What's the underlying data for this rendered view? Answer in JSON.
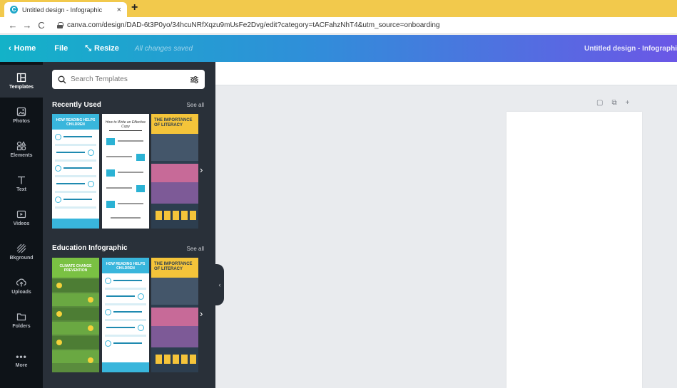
{
  "browser": {
    "tab_title": "Untitled design - Infographic",
    "tab_close": "×",
    "new_tab": "+",
    "back": "←",
    "forward": "→",
    "reload": "C",
    "url": "canva.com/design/DAD-6t3P0yo/34hcuNRfXqzu9mUsFe2Dvg/edit?category=tACFahzNhT4&utm_source=onboarding"
  },
  "appbar": {
    "home": "Home",
    "file": "File",
    "resize": "Resize",
    "saved_status": "All changes saved",
    "doc_title": "Untitled design - Infographi"
  },
  "rail": {
    "items": [
      {
        "label": "Templates",
        "icon": "templates-icon"
      },
      {
        "label": "Photos",
        "icon": "photos-icon"
      },
      {
        "label": "Elements",
        "icon": "elements-icon"
      },
      {
        "label": "Text",
        "icon": "text-icon"
      },
      {
        "label": "Videos",
        "icon": "videos-icon"
      },
      {
        "label": "Bkground",
        "icon": "background-icon"
      },
      {
        "label": "Uploads",
        "icon": "uploads-icon"
      },
      {
        "label": "Folders",
        "icon": "folders-icon"
      },
      {
        "label": "More",
        "icon": "more-icon"
      }
    ]
  },
  "panel": {
    "search_placeholder": "Search Templates",
    "sections": [
      {
        "title": "Recently Used",
        "see_all": "See all",
        "templates": [
          {
            "label": "HOW READING HELPS CHILDREN"
          },
          {
            "label": "How to Write an Effective Copy"
          },
          {
            "label": "THE IMPORTANCE OF LITERACY"
          }
        ]
      },
      {
        "title": "Education Infographic",
        "see_all": "See all",
        "templates": [
          {
            "label": "CLIMATE CHANGE PREVENTION"
          },
          {
            "label": "HOW READING HELPS CHILDREN"
          },
          {
            "label": "THE IMPORTANCE OF LITERACY"
          }
        ]
      }
    ],
    "next_arrow": "›",
    "collapse_arrow": "‹"
  },
  "canvas": {
    "tools": [
      "▢",
      "⧉",
      "+"
    ]
  },
  "colors": {
    "header_start": "#13b2c8",
    "header_end": "#6b57e6",
    "panel_bg": "#293039",
    "rail_bg": "#0e1318",
    "tab_bar": "#f2c94c"
  }
}
